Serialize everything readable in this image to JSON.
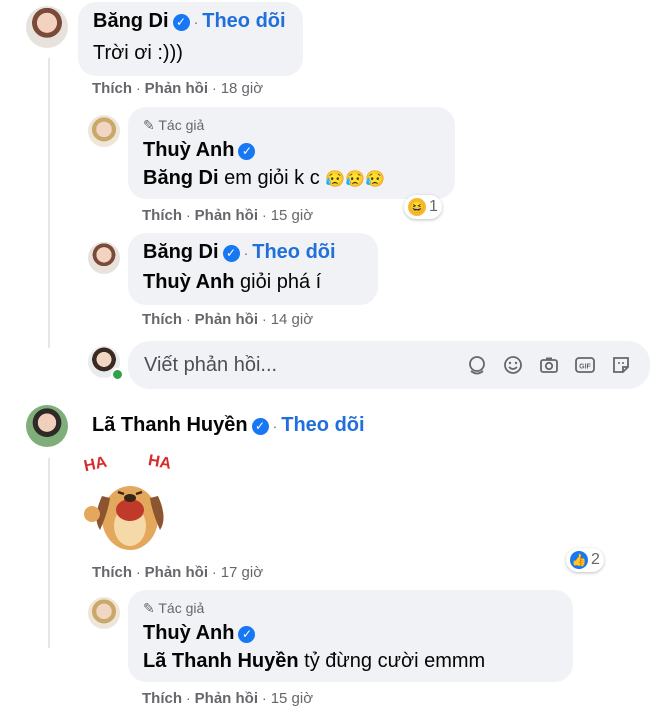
{
  "comments": [
    {
      "name": "Băng Di",
      "follow": "Theo dõi",
      "text": "Trời ơi :)))",
      "like": "Thích",
      "reply": "Phản hồi",
      "time": "18 giờ"
    },
    {
      "author_badge": "Tác giả",
      "name": "Thuỳ Anh",
      "mention": "Băng Di",
      "text": " em giỏi k c ",
      "emojis": "😥😥😥",
      "reaction_count": "1",
      "like": "Thích",
      "reply": "Phản hồi",
      "time": "15 giờ"
    },
    {
      "name": "Băng Di",
      "follow": "Theo dõi",
      "mention": "Thuỳ Anh",
      "text": " giỏi phá í",
      "like": "Thích",
      "reply": "Phản hồi",
      "time": "14 giờ"
    },
    {
      "name": "Lã Thanh Huyền",
      "follow": "Theo dõi",
      "sticker_text_left": "HA",
      "sticker_text_right": "HA",
      "reaction_count": "2",
      "like": "Thích",
      "reply": "Phản hồi",
      "time": "17 giờ"
    },
    {
      "author_badge": "Tác giả",
      "name": "Thuỳ Anh",
      "mention": "Lã Thanh Huyền",
      "text": " tỷ đừng cười emmm",
      "like": "Thích",
      "reply": "Phản hồi",
      "time": "15 giờ"
    }
  ],
  "reply_input": {
    "placeholder": "Viết phản hồi..."
  },
  "dot": "·",
  "colors": {
    "link": "#216fdb",
    "bubble": "#f0f2f5",
    "verified": "#1877f2",
    "muted": "#65676b"
  }
}
